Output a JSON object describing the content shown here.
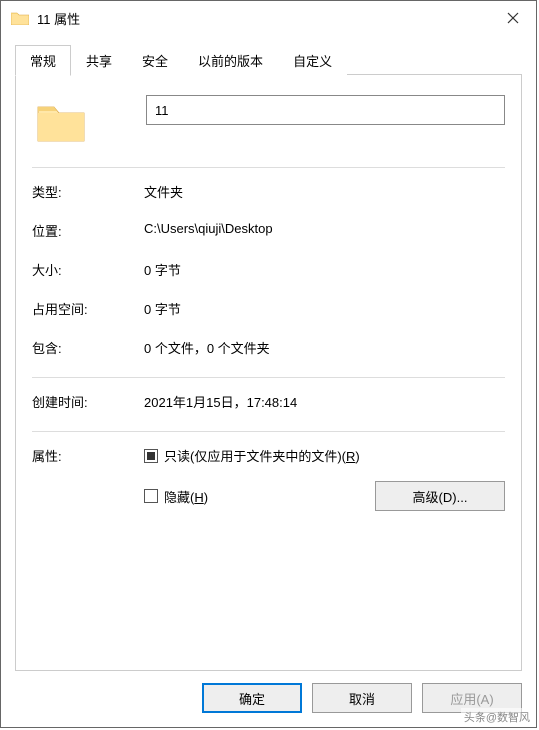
{
  "titlebar": {
    "title": "11 属性"
  },
  "tabs": {
    "general": "常规",
    "share": "共享",
    "security": "安全",
    "previous": "以前的版本",
    "custom": "自定义"
  },
  "folder": {
    "name": "11"
  },
  "props": {
    "type_label": "类型:",
    "type_value": "文件夹",
    "location_label": "位置:",
    "location_value": "C:\\Users\\qiuji\\Desktop",
    "size_label": "大小:",
    "size_value": "0 字节",
    "sizeondisk_label": "占用空间:",
    "sizeondisk_value": "0 字节",
    "contains_label": "包含:",
    "contains_value": "0 个文件，0 个文件夹",
    "created_label": "创建时间:",
    "created_value": "2021年1月15日，17:48:14",
    "attributes_label": "属性:"
  },
  "checkboxes": {
    "readonly_text": "只读(仅应用于文件夹中的文件)(",
    "readonly_key": "R",
    "readonly_after": ")",
    "hidden_text": "隐藏(",
    "hidden_key": "H",
    "hidden_after": ")"
  },
  "buttons": {
    "advanced": "高级(D)...",
    "ok": "确定",
    "cancel": "取消",
    "apply": "应用(A)"
  },
  "watermark": "头条@数智风"
}
